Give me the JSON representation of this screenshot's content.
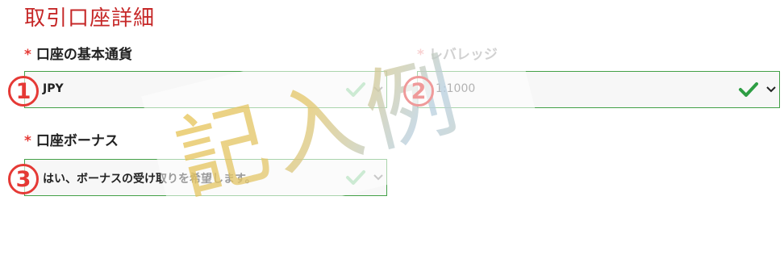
{
  "section_title": "取引口座詳細",
  "required_mark": "*",
  "base_currency": {
    "label": "口座の基本通貨",
    "value": "JPY"
  },
  "leverage": {
    "label": "レバレッジ",
    "value": "1:1000"
  },
  "bonus": {
    "label": "口座ボーナス",
    "value": "はい、ボーナスの受け取りを希望します。"
  },
  "markers": [
    "1",
    "2",
    "3"
  ],
  "watermark": "記入例",
  "colors": {
    "title": "#c62828",
    "required": "#e53935",
    "field_border": "#43a047",
    "check_dark": "#2e9e44",
    "check_light": "#8fd19e",
    "marker": "#e53935"
  },
  "icons": {
    "check": "check-icon",
    "chevron": "chevron-down-icon"
  }
}
